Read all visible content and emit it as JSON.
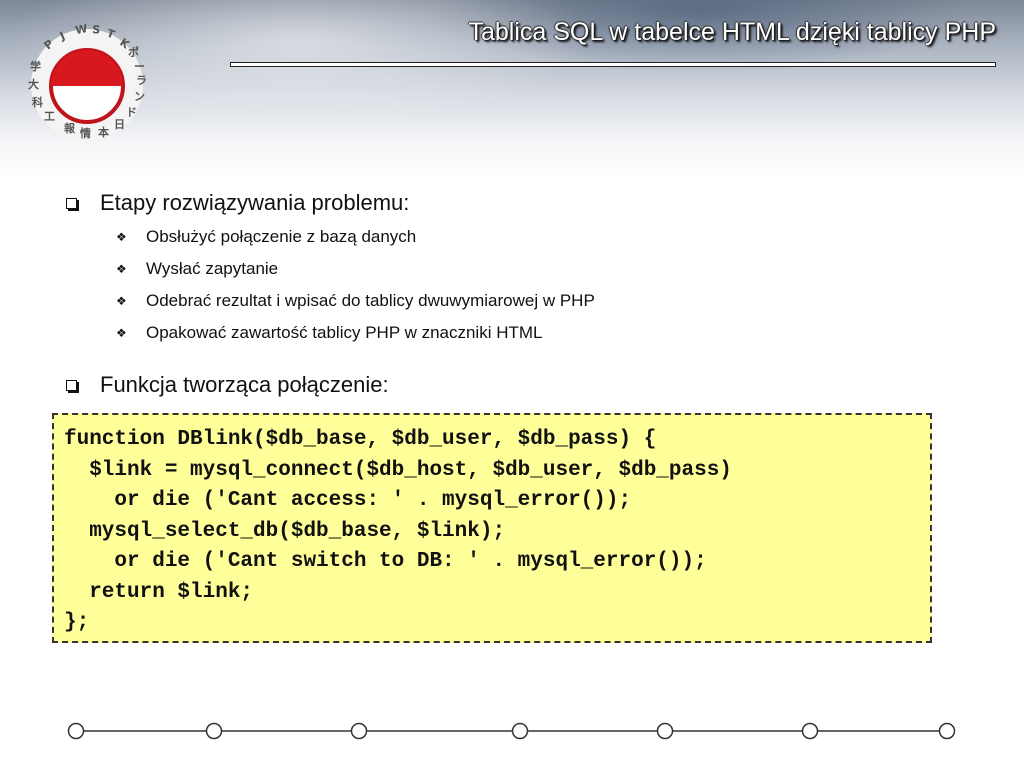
{
  "slide": {
    "title": "Tablica SQL w tabelce HTML dzięki tablicy PHP"
  },
  "logo": {
    "letters_latin": "PJWSTK",
    "letters_japanese": "ポーランド日本情報工科大学"
  },
  "bullets": [
    {
      "text": "Etapy rozwiązywania problemu:",
      "sub": [
        "Obsłużyć połączenie z bazą danych",
        "Wysłać zapytanie",
        "Odebrać rezultat i wpisać do tablicy dwuwymiarowej w PHP",
        "Opakować zawartość tablicy PHP w znaczniki HTML"
      ]
    },
    {
      "text": "Funkcja tworząca połączenie:",
      "sub": []
    }
  ],
  "code": {
    "lines": [
      "function DBlink($db_base, $db_user, $db_pass) {",
      "  $link = mysql_connect($db_host, $db_user, $db_pass)",
      "    or die ('Cant access: ' . mysql_error());",
      "  mysql_select_db($db_base, $link);",
      "    or die ('Cant switch to DB: ' . mysql_error());",
      "  return $link;",
      "};"
    ]
  },
  "timeline": {
    "node_count": 7
  },
  "colors": {
    "code_background": "#ffff99",
    "logo_red": "#d7191f"
  }
}
